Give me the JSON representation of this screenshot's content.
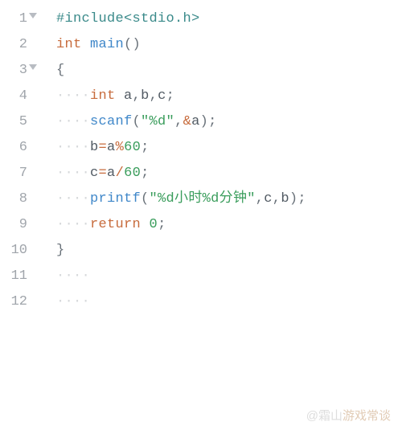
{
  "lines": [
    {
      "num": "1",
      "fold": true,
      "tokens": [
        [
          "preproc",
          "#include"
        ],
        [
          "preproc",
          "<stdio.h>"
        ]
      ]
    },
    {
      "num": "2",
      "fold": false,
      "tokens": [
        [
          "kw-type",
          "int"
        ],
        [
          "plain",
          " "
        ],
        [
          "fn",
          "main"
        ],
        [
          "punct",
          "()"
        ]
      ]
    },
    {
      "num": "3",
      "fold": true,
      "tokens": [
        [
          "punct",
          "{"
        ]
      ]
    },
    {
      "num": "4",
      "fold": false,
      "tokens": [
        [
          "ws",
          "····"
        ],
        [
          "kw-type",
          "int"
        ],
        [
          "plain",
          " a"
        ],
        [
          "punct",
          ","
        ],
        [
          "plain",
          "b"
        ],
        [
          "punct",
          ","
        ],
        [
          "plain",
          "c"
        ],
        [
          "punct",
          ";"
        ]
      ]
    },
    {
      "num": "5",
      "fold": false,
      "tokens": [
        [
          "ws",
          "····"
        ],
        [
          "fn",
          "scanf"
        ],
        [
          "punct",
          "("
        ],
        [
          "str",
          "\"%d\""
        ],
        [
          "punct",
          ","
        ],
        [
          "op",
          "&"
        ],
        [
          "plain",
          "a"
        ],
        [
          "punct",
          ")"
        ],
        [
          "punct",
          ";"
        ]
      ]
    },
    {
      "num": "6",
      "fold": false,
      "tokens": [
        [
          "ws",
          "····"
        ],
        [
          "plain",
          "b"
        ],
        [
          "op",
          "="
        ],
        [
          "plain",
          "a"
        ],
        [
          "op",
          "%"
        ],
        [
          "num",
          "60"
        ],
        [
          "punct",
          ";"
        ]
      ]
    },
    {
      "num": "7",
      "fold": false,
      "tokens": [
        [
          "ws",
          "····"
        ],
        [
          "plain",
          "c"
        ],
        [
          "op",
          "="
        ],
        [
          "plain",
          "a"
        ],
        [
          "op",
          "/"
        ],
        [
          "num",
          "60"
        ],
        [
          "punct",
          ";"
        ]
      ]
    },
    {
      "num": "8",
      "fold": false,
      "tokens": [
        [
          "ws",
          "····"
        ],
        [
          "fn",
          "printf"
        ],
        [
          "punct",
          "("
        ],
        [
          "str",
          "\"%d小时%d分钟\""
        ],
        [
          "punct",
          ","
        ],
        [
          "plain",
          "c"
        ],
        [
          "punct",
          ","
        ],
        [
          "plain",
          "b"
        ],
        [
          "punct",
          ")"
        ],
        [
          "punct",
          ";"
        ]
      ]
    },
    {
      "num": "9",
      "fold": false,
      "tokens": [
        [
          "ws",
          "····"
        ],
        [
          "kw-ctrl",
          "return"
        ],
        [
          "plain",
          " "
        ],
        [
          "num",
          "0"
        ],
        [
          "punct",
          ";"
        ]
      ]
    },
    {
      "num": "10",
      "fold": false,
      "tokens": [
        [
          "punct",
          "}"
        ]
      ]
    },
    {
      "num": "11",
      "fold": false,
      "tokens": [
        [
          "ws",
          "····"
        ]
      ]
    },
    {
      "num": "12",
      "fold": false,
      "tokens": [
        [
          "ws",
          "····"
        ]
      ]
    }
  ],
  "watermark": {
    "faint": "@霜山",
    "main": "游戏常谈"
  }
}
